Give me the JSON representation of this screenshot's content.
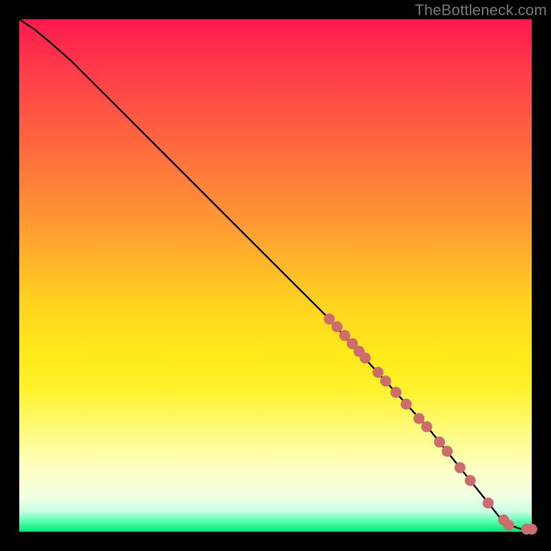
{
  "watermark": "TheBottleneck.com",
  "colors": {
    "curve_stroke": "#000000",
    "dot_fill": "#cd6c6c",
    "frame_bg": "#000000"
  },
  "chart_data": {
    "type": "line",
    "title": "",
    "xlabel": "",
    "ylabel": "",
    "xlim": [
      0,
      100
    ],
    "ylim": [
      0,
      100
    ],
    "series": [
      {
        "name": "curve",
        "x": [
          0,
          3,
          6,
          10,
          20,
          30,
          40,
          50,
          60,
          70,
          80,
          88,
          92,
          94,
          95,
          98,
          100
        ],
        "y": [
          100,
          98,
          95.5,
          92,
          82,
          72,
          62,
          52,
          42,
          31,
          20,
          10,
          5,
          2.5,
          1.5,
          0.5,
          0.5
        ]
      }
    ],
    "dots": [
      {
        "x": 60.5,
        "y": 41.5
      },
      {
        "x": 62.0,
        "y": 40.0
      },
      {
        "x": 63.5,
        "y": 38.3
      },
      {
        "x": 65.0,
        "y": 36.7
      },
      {
        "x": 66.3,
        "y": 35.2
      },
      {
        "x": 67.5,
        "y": 33.9
      },
      {
        "x": 70.0,
        "y": 31.1
      },
      {
        "x": 71.5,
        "y": 29.4
      },
      {
        "x": 73.5,
        "y": 27.2
      },
      {
        "x": 75.5,
        "y": 24.9
      },
      {
        "x": 78.0,
        "y": 22.1
      },
      {
        "x": 79.5,
        "y": 20.5
      },
      {
        "x": 82.0,
        "y": 17.5
      },
      {
        "x": 83.5,
        "y": 15.7
      },
      {
        "x": 86.0,
        "y": 12.5
      },
      {
        "x": 88.0,
        "y": 10.0
      },
      {
        "x": 91.5,
        "y": 5.6
      },
      {
        "x": 94.5,
        "y": 2.3
      },
      {
        "x": 95.5,
        "y": 1.3
      },
      {
        "x": 99.0,
        "y": 0.5
      },
      {
        "x": 100.0,
        "y": 0.5
      }
    ],
    "dot_radius_px": 8
  }
}
